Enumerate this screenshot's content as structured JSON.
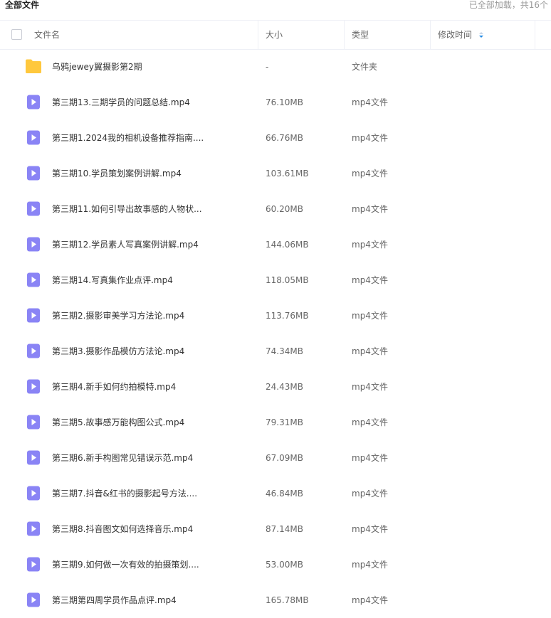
{
  "breadcrumb": "全部文件",
  "load_status": "已全部加载，共16个",
  "columns": {
    "name": "文件名",
    "size": "大小",
    "type": "类型",
    "modified": "修改时间"
  },
  "colors": {
    "folder": "#FFC83D",
    "video": "#8A84F5",
    "sort_active": "#1E88E5"
  },
  "files": [
    {
      "name": "乌鸦jewey翼摄影第2期",
      "size": "-",
      "type": "文件夹",
      "icon": "folder-icon"
    },
    {
      "name": "第三期13.三期学员的问题总结.mp4",
      "size": "76.10MB",
      "type": "mp4文件",
      "icon": "video-file-icon"
    },
    {
      "name": "第三期1.2024我的相机设备推荐指南....",
      "size": "66.76MB",
      "type": "mp4文件",
      "icon": "video-file-icon"
    },
    {
      "name": "第三期10.学员策划案例讲解.mp4",
      "size": "103.61MB",
      "type": "mp4文件",
      "icon": "video-file-icon"
    },
    {
      "name": "第三期11.如何引导出故事感的人物状...",
      "size": "60.20MB",
      "type": "mp4文件",
      "icon": "video-file-icon"
    },
    {
      "name": "第三期12.学员素人写真案例讲解.mp4",
      "size": "144.06MB",
      "type": "mp4文件",
      "icon": "video-file-icon"
    },
    {
      "name": "第三期14.写真集作业点评.mp4",
      "size": "118.05MB",
      "type": "mp4文件",
      "icon": "video-file-icon"
    },
    {
      "name": "第三期2.摄影审美学习方法论.mp4",
      "size": "113.76MB",
      "type": "mp4文件",
      "icon": "video-file-icon"
    },
    {
      "name": "第三期3.摄影作品模仿方法论.mp4",
      "size": "74.34MB",
      "type": "mp4文件",
      "icon": "video-file-icon"
    },
    {
      "name": "第三期4.新手如何约拍模特.mp4",
      "size": "24.43MB",
      "type": "mp4文件",
      "icon": "video-file-icon"
    },
    {
      "name": "第三期5.故事感万能构图公式.mp4",
      "size": "79.31MB",
      "type": "mp4文件",
      "icon": "video-file-icon"
    },
    {
      "name": "第三期6.新手构图常见错误示范.mp4",
      "size": "67.09MB",
      "type": "mp4文件",
      "icon": "video-file-icon"
    },
    {
      "name": "第三期7.抖音&红书的摄影起号方法....",
      "size": "46.84MB",
      "type": "mp4文件",
      "icon": "video-file-icon"
    },
    {
      "name": "第三期8.抖音图文如何选择音乐.mp4",
      "size": "87.14MB",
      "type": "mp4文件",
      "icon": "video-file-icon"
    },
    {
      "name": "第三期9.如何做一次有效的拍摄策划....",
      "size": "53.00MB",
      "type": "mp4文件",
      "icon": "video-file-icon"
    },
    {
      "name": "第三期第四周学员作品点评.mp4",
      "size": "165.78MB",
      "type": "mp4文件",
      "icon": "video-file-icon"
    }
  ]
}
